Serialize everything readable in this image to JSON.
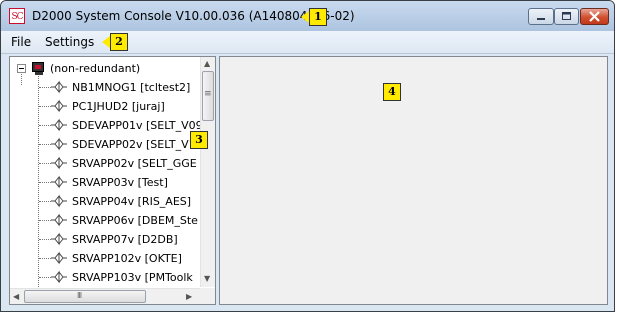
{
  "window": {
    "title": "D2000 System Console V10.00.036 (A140804036-02)",
    "icon_text": "SC"
  },
  "menu": {
    "items": [
      "File",
      "Settings"
    ]
  },
  "tree": {
    "root_label": "(non-redundant)",
    "nodes": [
      "NB1MNOG1 [tcltest2]",
      "PC1JHUD2 [juraj]",
      "SDEVAPP01v [SELT_V09",
      "SDEVAPP02v [SELT_V10",
      "SRVAPP02v [SELT_GGE",
      "SRVAPP03v [Test]",
      "SRVAPP04v [RIS_AES]",
      "SRVAPP06v [DBEM_Ste",
      "SRVAPP07v [D2DB]",
      "SRVAPP102v [OKTE]",
      "SRVAPP103v [PMToolk"
    ]
  },
  "scrollbars": {
    "vertical_thumb_grip": "≡",
    "horizontal_thumb_grip": "III",
    "up": "▲",
    "down": "▼",
    "left": "◀",
    "right": "▶"
  },
  "annotations": {
    "title_marker": "1",
    "menu_marker": "2",
    "tree_marker": "3",
    "detail_marker": "4"
  },
  "colors": {
    "marker_fill": "#ffea00",
    "icon_red": "#c8102e",
    "close_button": "#c1391a"
  }
}
